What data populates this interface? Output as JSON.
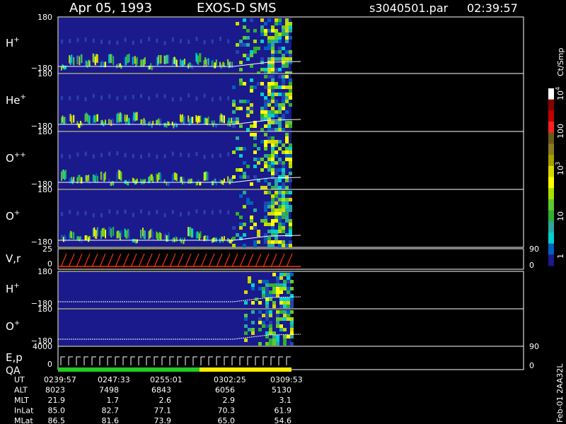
{
  "header": {
    "date": "Apr 05, 1993",
    "instrument": "EXOS-D SMS",
    "file": "s3040501.par",
    "time": "02:39:57"
  },
  "footer_note": "Feb-01 2AA32L",
  "colors": {
    "background": "#000000",
    "spectrogram_bg": "#1a1a8c",
    "velocity_trace": "#ff3010",
    "qa_bar": [
      "#22cc22",
      "#ffee00"
    ]
  },
  "chart_data": {
    "type": "heatmap",
    "panels": [
      {
        "label": "H",
        "sup": "+",
        "ylim": [
          -180,
          180
        ],
        "ticks": [
          "180",
          "−180"
        ]
      },
      {
        "label": "He",
        "sup": "+",
        "ylim": [
          -180,
          180
        ],
        "ticks": [
          "180",
          "−180"
        ]
      },
      {
        "label": "O",
        "sup": "++",
        "ylim": [
          -180,
          180
        ],
        "ticks": [
          "180",
          "−180"
        ]
      },
      {
        "label": "O",
        "sup": "+",
        "ylim": [
          -180,
          180
        ],
        "ticks": [
          "180",
          "−180"
        ]
      },
      {
        "label": "V,r",
        "sup": "",
        "ylim": [
          0,
          25
        ],
        "ticks": [
          "25",
          "0"
        ],
        "right_ticks": [
          "90",
          "0"
        ]
      },
      {
        "label": "H",
        "sup": "+",
        "ylim": [
          -180,
          180
        ],
        "ticks": [
          "180",
          "−180"
        ]
      },
      {
        "label": "O",
        "sup": "+",
        "ylim": [
          -180,
          180
        ],
        "ticks": [
          "180",
          "−180"
        ]
      },
      {
        "label": "E,p",
        "sup": "",
        "label2": "QA",
        "ylim": [
          0,
          4000
        ],
        "ticks": [
          "4000",
          "0"
        ],
        "right_ticks": [
          "90",
          "0"
        ]
      }
    ],
    "colorbar": {
      "unit": "Ct/Smp",
      "labels": [
        "10",
        "100",
        "10",
        "10",
        "1"
      ],
      "label_sups": [
        "4",
        "",
        "3",
        "",
        ""
      ],
      "label_positions_note": "log scale 1 to 10^4",
      "colors": [
        "#ffffff",
        "#8b0000",
        "#c00000",
        "#ff2020",
        "#6b5a1a",
        "#8a7a20",
        "#a8a000",
        "#d8d800",
        "#ffff00",
        "#a8e000",
        "#60c830",
        "#30b030",
        "#2aa8a0",
        "#00d0d0",
        "#0060c0",
        "#1a1a8c"
      ]
    },
    "x_axis": {
      "times": [
        "0239:57",
        "0247:33",
        "0255:01",
        "0302:25",
        "0309:53"
      ]
    },
    "ephemeris": [
      {
        "name": "UT",
        "values": [
          "0239:57",
          "0247:33",
          "0255:01",
          "0302:25",
          "0309:53"
        ]
      },
      {
        "name": "ALT",
        "values": [
          "8023",
          "7498",
          "6843",
          "6056",
          "5130"
        ]
      },
      {
        "name": "MLT",
        "values": [
          "21.9",
          "1.7",
          "2.6",
          "2.9",
          "3.1"
        ]
      },
      {
        "name": "InLat",
        "values": [
          "85.0",
          "82.7",
          "77.1",
          "70.3",
          "61.9"
        ]
      },
      {
        "name": "MLat",
        "values": [
          "86.5",
          "81.6",
          "73.9",
          "65.0",
          "54.6"
        ]
      }
    ]
  }
}
